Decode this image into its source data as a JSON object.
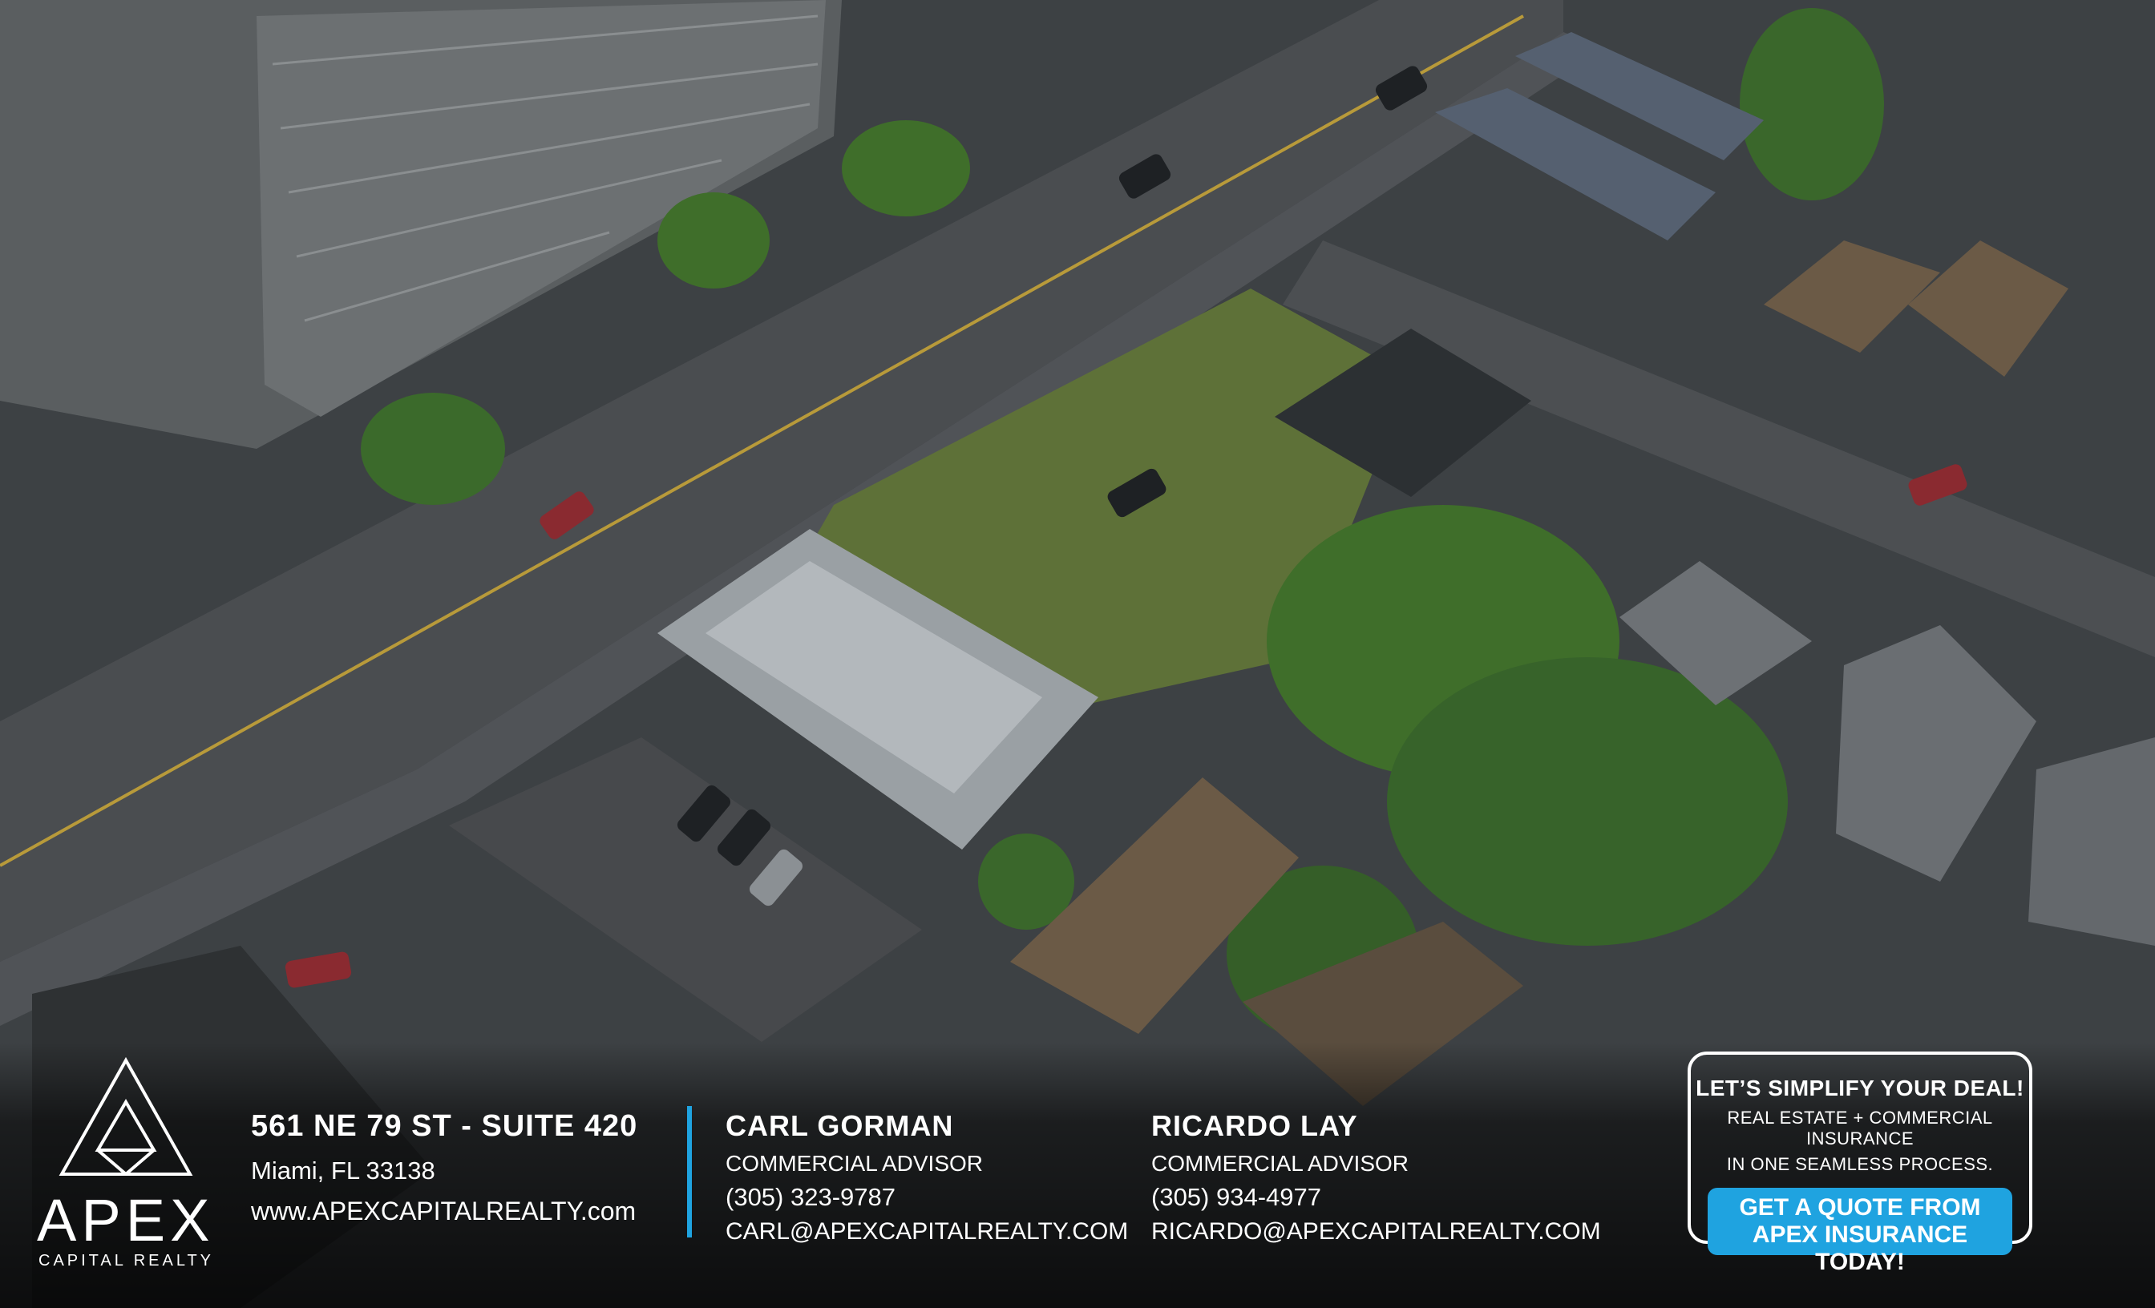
{
  "brand": {
    "name": "APEX",
    "tagline": "CAPITAL REALTY"
  },
  "office": {
    "address": "561 NE 79 ST - SUITE 420",
    "city": "Miami, FL 33138",
    "website": "www.APEXCAPITALREALTY.com"
  },
  "agents": [
    {
      "name": "CARL GORMAN",
      "title": "COMMERCIAL ADVISOR",
      "phone": "(305) 323-9787",
      "email": "CARL@APEXCAPITALREALTY.COM"
    },
    {
      "name": "RICARDO LAY",
      "title": "COMMERCIAL ADVISOR",
      "phone": "(305) 934-4977",
      "email": "RICARDO@APEXCAPITALREALTY.COM"
    }
  ],
  "promo": {
    "headline": "LET’S SIMPLIFY YOUR DEAL!",
    "line1": "REAL ESTATE + COMMERCIAL INSURANCE",
    "line2": "IN ONE SEAMLESS PROCESS.",
    "cta_line1": "GET A QUOTE FROM",
    "cta_line2": "APEX INSURANCE TODAY!"
  },
  "colors": {
    "accent": "#1fa3e0",
    "text": "#ffffff"
  }
}
